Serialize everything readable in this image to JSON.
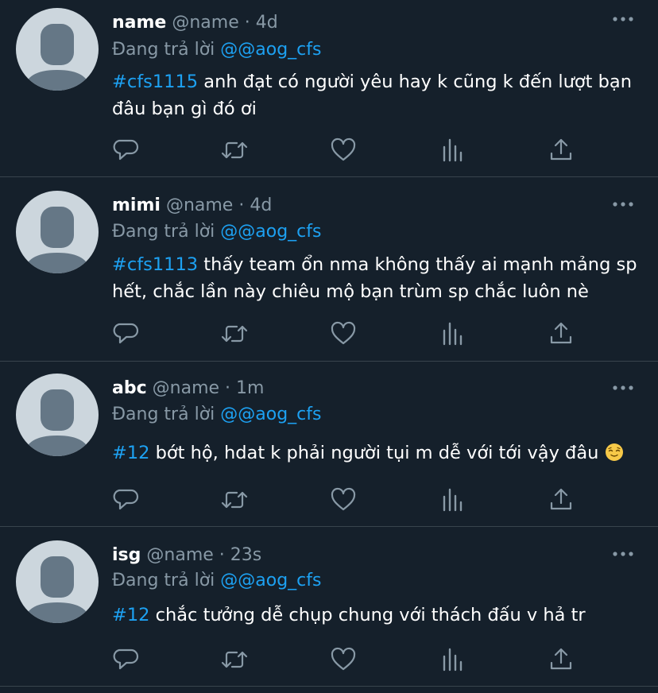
{
  "tweets": [
    {
      "name": "name",
      "handle": "@name",
      "sep": "·",
      "time": "4d",
      "reply_prefix": "Đang trả lời",
      "reply_to": "@@aog_cfs",
      "hashtag": "#cfs1115",
      "text": " anh đạt có người yêu hay k cũng k đến lượt bạn đâu bạn gì đó ơi"
    },
    {
      "name": "mimi",
      "handle": "@name",
      "sep": "·",
      "time": "4d",
      "reply_prefix": "Đang trả lời",
      "reply_to": "@@aog_cfs",
      "hashtag": "#cfs1113",
      "text": " thấy team ổn nma không thấy ai mạnh mảng sp hết, chắc lần này chiêu mộ bạn trùm sp chắc luôn nè"
    },
    {
      "name": "abc",
      "handle": "@name",
      "sep": "·",
      "time": "1m",
      "reply_prefix": "Đang trả lời",
      "reply_to": "@@aog_cfs",
      "hashtag": "#12",
      "text": " bớt hộ, hdat k phải người tụi m dễ với tới vậy đâu "
    },
    {
      "name": "isg",
      "handle": "@name",
      "sep": "·",
      "time": "23s",
      "reply_prefix": "Đang trả lời",
      "reply_to": "@@aog_cfs",
      "hashtag": "#12",
      "text": " chắc tưởng dễ chụp chung với thách đấu v hả tr"
    }
  ],
  "icons": {
    "reply": "reply-icon",
    "retweet": "retweet-icon",
    "like": "like-icon",
    "analytics": "analytics-icon",
    "share": "share-icon",
    "more": "more-icon",
    "emoji": "relieved-face-emoji"
  },
  "colors": {
    "background": "#15202b",
    "divider": "#38444d",
    "accent": "#1da1f2",
    "muted": "#8899a6",
    "text": "#ffffff",
    "avatar_bg": "#ccd6dd",
    "avatar_fg": "#657786"
  }
}
